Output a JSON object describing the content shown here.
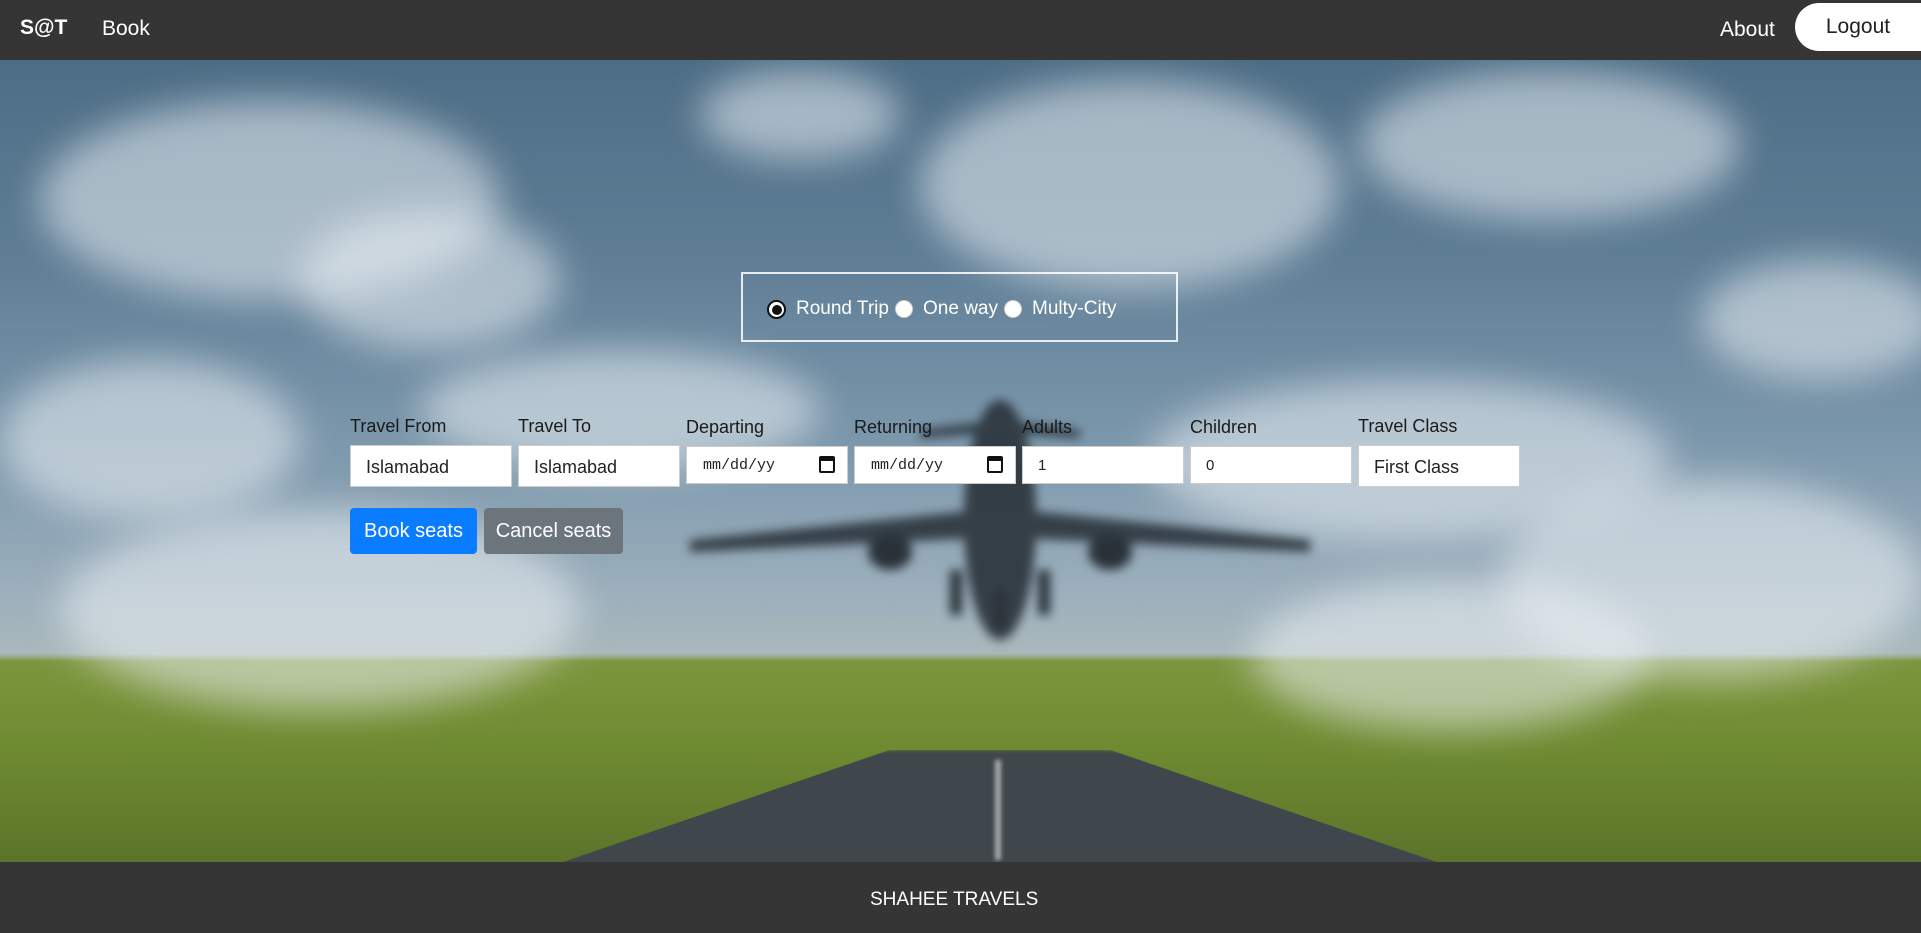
{
  "navbar": {
    "brand": "S@T",
    "book_label": "Book",
    "about_label": "About",
    "logout_label": "Logout"
  },
  "trip_type": {
    "options": [
      {
        "label": "Round Trip",
        "checked": true
      },
      {
        "label": "One way",
        "checked": false
      },
      {
        "label": "Multy-City",
        "checked": false
      }
    ]
  },
  "form": {
    "travel_from": {
      "label": "Travel From",
      "value": "Islamabad"
    },
    "travel_to": {
      "label": "Travel To",
      "value": "Islamabad"
    },
    "departing": {
      "label": "Departing",
      "placeholder": "mm/dd/yy"
    },
    "returning": {
      "label": "Returning",
      "placeholder": "mm/dd/yy"
    },
    "adults": {
      "label": "Adults",
      "value": "1"
    },
    "children": {
      "label": "Children",
      "value": "0"
    },
    "travel_class": {
      "label": "Travel Class",
      "value": "First Class"
    }
  },
  "buttons": {
    "book_label": "Book seats",
    "cancel_label": "Cancel seats"
  },
  "footer": {
    "text": "SHAHEE TRAVELS"
  },
  "colors": {
    "navbar_bg": "#353535",
    "primary": "#0a7cff",
    "secondary": "#6c747c"
  },
  "background_image": "airplane-takeoff-runway"
}
